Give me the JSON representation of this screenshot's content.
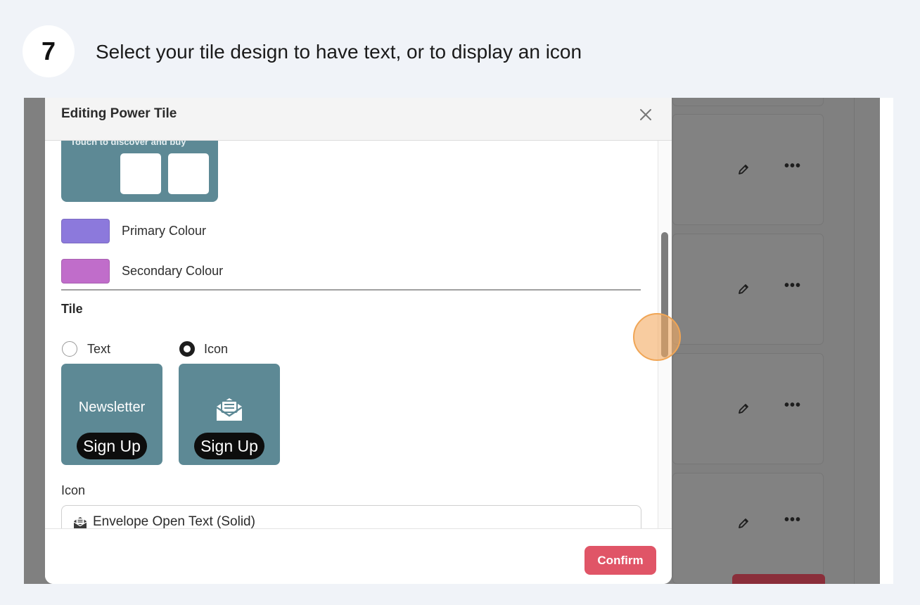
{
  "step": {
    "number": "7",
    "instruction": "Select your tile design to have text, or to display an icon"
  },
  "modal": {
    "title": "Editing Power Tile",
    "preview_text": "Touch to discover and buy",
    "colours": {
      "primary": {
        "label": "Primary Colour",
        "hex": "#8c79dc"
      },
      "secondary": {
        "label": "Secondary Colour",
        "hex": "#c06dca"
      }
    },
    "tile_section": {
      "title": "Tile",
      "options": [
        {
          "label": "Text",
          "selected": false
        },
        {
          "label": "Icon",
          "selected": true
        }
      ],
      "text_tile": {
        "heading": "Newsletter",
        "pill": "Sign Up"
      },
      "icon_tile": {
        "icon": "envelope-open-text-icon",
        "pill": "Sign Up"
      },
      "tile_color": "#5d8995"
    },
    "icon_field": {
      "label": "Icon",
      "value": "Envelope Open Text (Solid)",
      "icon": "envelope-open-text-icon"
    },
    "confirm_label": "Confirm"
  },
  "colors": {
    "accent": "#e05567",
    "backdrop": "#808080",
    "click_marker": "#f4aa60"
  }
}
